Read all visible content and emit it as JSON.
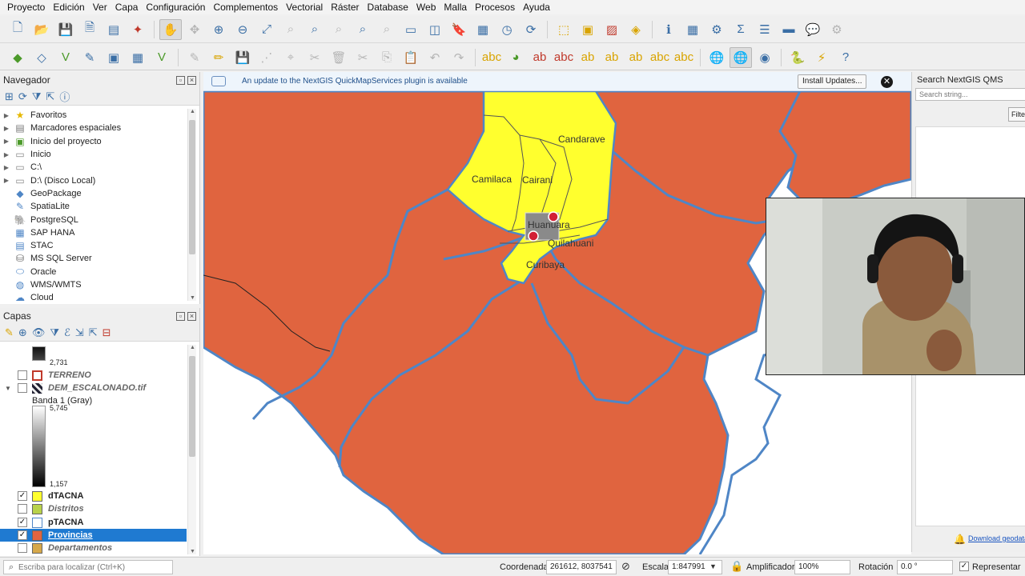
{
  "menubar": [
    "Proyecto",
    "Edición",
    "Ver",
    "Capa",
    "Configuración",
    "Complementos",
    "Vectorial",
    "Ráster",
    "Database",
    "Web",
    "Malla",
    "Procesos",
    "Ayuda"
  ],
  "navigator": {
    "title": "Navegador",
    "items": [
      {
        "label": "Favoritos",
        "icon": "star-icon"
      },
      {
        "label": "Marcadores espaciales",
        "icon": "bookmark-icon"
      },
      {
        "label": "Inicio del proyecto",
        "icon": "project-home-icon"
      },
      {
        "label": "Inicio",
        "icon": "folder-icon"
      },
      {
        "label": "C:\\",
        "icon": "folder-icon"
      },
      {
        "label": "D:\\ (Disco Local)",
        "icon": "folder-icon"
      },
      {
        "label": "GeoPackage",
        "icon": "geopackage-icon"
      },
      {
        "label": "SpatiaLite",
        "icon": "spatialite-icon"
      },
      {
        "label": "PostgreSQL",
        "icon": "postgresql-icon"
      },
      {
        "label": "SAP HANA",
        "icon": "sap-hana-icon"
      },
      {
        "label": "STAC",
        "icon": "stac-icon"
      },
      {
        "label": "MS SQL Server",
        "icon": "mssql-icon"
      },
      {
        "label": "Oracle",
        "icon": "oracle-icon"
      },
      {
        "label": "WMS/WMTS",
        "icon": "globe-icon"
      },
      {
        "label": "Cloud",
        "icon": "cloud-icon"
      }
    ]
  },
  "layers": {
    "title": "Capas",
    "ramp_top_value": "2,731",
    "terreno": "TERRENO",
    "dem": "DEM_ESCALONADO.tif",
    "band": "Banda 1 (Gray)",
    "dem_max": "5,745",
    "dem_min": "1,157",
    "items": [
      {
        "name": "dTACNA",
        "checked": true,
        "color": "#ffff2e"
      },
      {
        "name": "Distritos",
        "checked": false,
        "color": "#b8d24a"
      },
      {
        "name": "pTACNA",
        "checked": true,
        "color": "#ffffff"
      },
      {
        "name": "Provincias",
        "checked": true,
        "color": "#e0643f"
      },
      {
        "name": "Departamentos",
        "checked": false,
        "color": "#d6a84a"
      }
    ]
  },
  "notification": {
    "message": "An update to the NextGIS QuickMapServices plugin is available",
    "install_label": "Install Updates..."
  },
  "qms": {
    "title": "Search NextGIS QMS",
    "search_placeholder": "Search string...",
    "filter_label": "Filte",
    "footer_link": "Download geodata"
  },
  "map_labels": [
    "Candarave",
    "Camilaca",
    "Cairani",
    "Huanuara",
    "Quilahuani",
    "Curibaya"
  ],
  "statusbar": {
    "locator_placeholder": "Escriba para localizar (Ctrl+K)",
    "coord_label": "Coordenada",
    "coord_value": "261612, 8037541",
    "scale_label": "Escala",
    "scale_value": "1:847991",
    "magnifier_label": "Amplificador",
    "magnifier_value": "100%",
    "rotation_label": "Rotación",
    "rotation_value": "0.0 °",
    "render_label": "Representar",
    "render_checked": true
  },
  "colors": {
    "province_fill": "#e0643f",
    "district_fill": "#ffff2e",
    "boundary": "#4f86c6",
    "selection": "#1f7ad1"
  }
}
